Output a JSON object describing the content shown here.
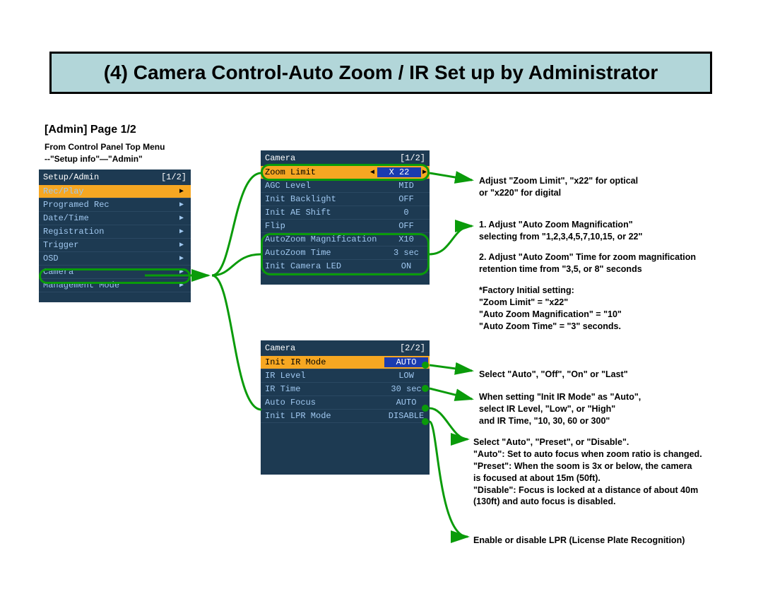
{
  "title": "(4) Camera Control-Auto Zoom / IR Set up by Administrator",
  "page_label": "[Admin]  Page 1/2",
  "sub_label_1": "From Control Panel Top Menu",
  "sub_label_2": "--\"Setup info\"—\"Admin\"",
  "panelA": {
    "hdr_l": "Setup/Admin",
    "hdr_r": "[1/2]",
    "rows": [
      {
        "label": "Rec/Play",
        "sel": true
      },
      {
        "label": "Programed Rec"
      },
      {
        "label": "Date/Time"
      },
      {
        "label": "Registration"
      },
      {
        "label": "Trigger"
      },
      {
        "label": "OSD"
      },
      {
        "label": "Camera"
      },
      {
        "label": "Management Mode"
      }
    ]
  },
  "panelB": {
    "hdr_l": "Camera",
    "hdr_r": "[1/2]",
    "rows": [
      {
        "label": "Zoom Limit",
        "val": "X 22",
        "sel": true
      },
      {
        "label": "AGC Level",
        "val": "MID"
      },
      {
        "label": "Init Backlight",
        "val": "OFF"
      },
      {
        "label": "Init AE Shift",
        "val": "0"
      },
      {
        "label": "Flip",
        "val": "OFF"
      },
      {
        "label": "AutoZoom Magnification",
        "val": "X10"
      },
      {
        "label": "AutoZoom Time",
        "val": "3 sec"
      },
      {
        "label": "Init Camera LED",
        "val": "ON"
      }
    ]
  },
  "panelC": {
    "hdr_l": "Camera",
    "hdr_r": "[2/2]",
    "rows": [
      {
        "label": "Init IR Mode",
        "val": "AUTO",
        "sel": true
      },
      {
        "label": "IR Level",
        "val": "LOW"
      },
      {
        "label": "IR Time",
        "val": "30 sec"
      },
      {
        "label": "Auto Focus",
        "val": "AUTO"
      },
      {
        "label": "Init LPR Mode",
        "val": "DISABLE"
      }
    ]
  },
  "anno": {
    "a1": "Adjust \"Zoom Limit\", \"x22\" for optical\nor \"x220\" for digital",
    "a2": "1.  Adjust \"Auto Zoom Magnification\"\nselecting from \"1,2,3,4,5,7,10,15, or 22\"",
    "a3": "2. Adjust \"Auto Zoom\" Time for zoom magnification\nretention time from \"3,5, or 8\" seconds",
    "a4": "*Factory Initial setting:\n\"Zoom Limit\" = \"x22\"\n\"Auto Zoom Magnification\" = \"10\"\n\"Auto Zoom Time\" = \"3\" seconds.",
    "a5": "Select \"Auto\", \"Off\", \"On\" or \"Last\"",
    "a6": "When setting \"Init IR Mode\" as \"Auto\",\nselect IR Level, \"Low\", or \"High\"\nand IR Time, \"10, 30, 60 or 300\"",
    "a7": "Select \"Auto\", \"Preset\", or \"Disable\".\n\"Auto\": Set to auto focus when zoom ratio is changed.\n\"Preset\": When the soom is 3x or below, the camera\nis focused at about 15m (50ft).\n\"Disable\": Focus is locked at a distance of about 40m\n(130ft) and auto focus is disabled.",
    "a8": "Enable or disable LPR (License Plate Recognition)"
  }
}
